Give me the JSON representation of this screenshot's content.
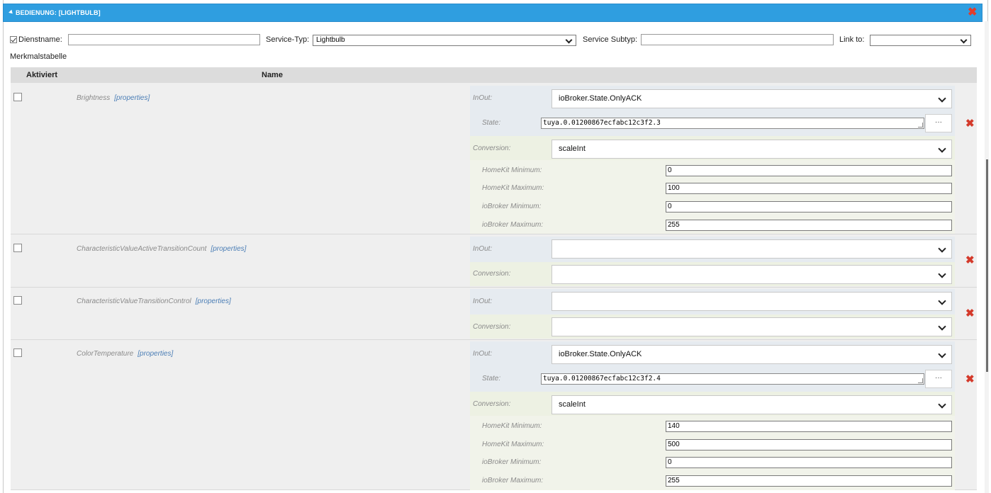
{
  "panel": {
    "title": "BEDIENUNG: [LIGHTBULB]",
    "close_glyph": "✖"
  },
  "form": {
    "dienstname_label": "Dienstname:",
    "dienstname_value": "",
    "service_typ_label": "Service-Typ:",
    "service_typ_value": "Lightbulb",
    "service_subtyp_label": "Service Subtyp:",
    "service_subtyp_value": "",
    "link_to_label": "Link to:",
    "link_to_value": "",
    "merkmalstabelle_label": "Merkmalstabelle"
  },
  "table": {
    "col_aktiviert": "Aktiviert",
    "col_name": "Name"
  },
  "labels": {
    "properties": "[properties]",
    "inout": "InOut:",
    "state": "State:",
    "conversion": "Conversion:",
    "hk_min": "HomeKit Minimum:",
    "hk_max": "HomeKit Maximum:",
    "iob_min": "ioBroker Minimum:",
    "iob_max": "ioBroker Maximum:",
    "dots": "···",
    "delete_glyph": "✖"
  },
  "rows": [
    {
      "name": "Brightness",
      "inout": "ioBroker.State.OnlyACK",
      "state": "tuya.0.01200867ecfabc12c3f2.3",
      "conversion": "scaleInt",
      "hk_min": "0",
      "hk_max": "100",
      "iob_min": "0",
      "iob_max": "255"
    },
    {
      "name": "CharacteristicValueActiveTransitionCount",
      "inout": "",
      "conversion": ""
    },
    {
      "name": "CharacteristicValueTransitionControl",
      "inout": "",
      "conversion": ""
    },
    {
      "name": "ColorTemperature",
      "inout": "ioBroker.State.OnlyACK",
      "state": "tuya.0.01200867ecfabc12c3f2.4",
      "conversion": "scaleInt",
      "hk_min": "140",
      "hk_max": "500",
      "iob_min": "0",
      "iob_max": "255"
    }
  ]
}
